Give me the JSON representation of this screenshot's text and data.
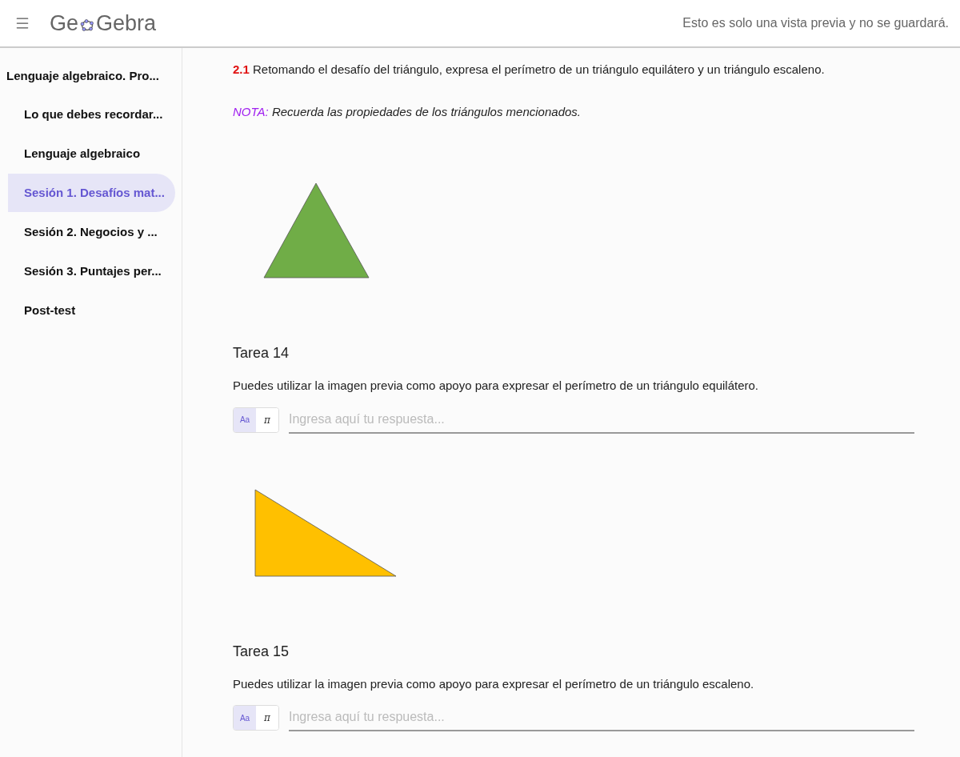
{
  "header": {
    "logo_start": "Ge",
    "logo_end": "Gebra",
    "notice": "Esto es solo una vista previa y no se guardará."
  },
  "sidebar": {
    "title": "Lenguaje algebraico. Pro...",
    "items": [
      {
        "label": "Lo que debes recordar...",
        "selected": false
      },
      {
        "label": "Lenguaje algebraico",
        "selected": false
      },
      {
        "label": "Sesión 1. Desafíos mat...",
        "selected": true
      },
      {
        "label": "Sesión 2. Negocios y ...",
        "selected": false
      },
      {
        "label": "Sesión 3. Puntajes per...",
        "selected": false
      },
      {
        "label": "Post-test",
        "selected": false
      }
    ]
  },
  "content": [
    {
      "kind": "text",
      "text": "**2.1** Retomando el desafío del triángulo, expresa el perímetro de un triángulo equilátero y un triángulo escaleno."
    },
    {
      "kind": "note",
      "label": "NOTA:",
      "text": "Recuerda las propiedades de los triángulos mencionados."
    },
    {
      "kind": "equilateral_triangle",
      "color": "#70ad47"
    },
    {
      "kind": "task",
      "title": "Tarea 14",
      "text": "Puedes utilizar la imagen previa como apoyo para expresar el perímetro de un triángulo equilátero.",
      "modes": [
        {
          "label": "Aa",
          "selected": true
        },
        {
          "label": "π",
          "selected": false
        }
      ],
      "placeholder": "Ingresa aquí tu respuesta..."
    },
    {
      "kind": "right_triangle",
      "color": "#ffc000"
    },
    {
      "kind": "task",
      "title": "Tarea 15",
      "text": "Puedes utilizar la imagen previa como apoyo para expresar el perímetro de un triángulo escaleno.",
      "modes": [
        {
          "label": "Aa",
          "selected": true
        },
        {
          "label": "π",
          "selected": false
        }
      ],
      "placeholder": "Ingresa aquí tu respuesta..."
    }
  ]
}
